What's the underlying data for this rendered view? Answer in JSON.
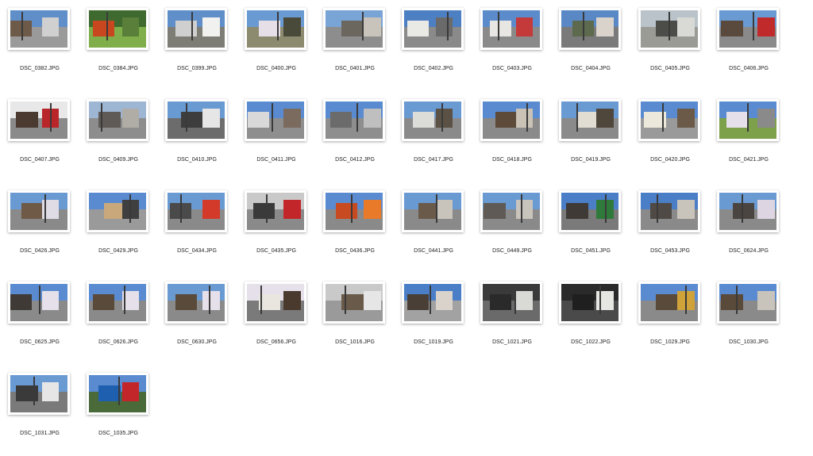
{
  "files": [
    {
      "name": "DSC_0382.JPG",
      "sky": "#5f8ec9",
      "ground": "#9a9a9a",
      "building": "#6e5a48",
      "accent": "#d0d0d0"
    },
    {
      "name": "DSC_0384.JPG",
      "sky": "#3f6a2f",
      "ground": "#7fae4a",
      "building": "#c9471f",
      "accent": "#5a7f3a"
    },
    {
      "name": "DSC_0399.JPG",
      "sky": "#5f8ec9",
      "ground": "#7e7d75",
      "building": "#cfcfcf",
      "accent": "#f1f1ef"
    },
    {
      "name": "DSC_0400.JPG",
      "sky": "#6a9ad2",
      "ground": "#8c8a6f",
      "building": "#e6dfe8",
      "accent": "#4a4a3a"
    },
    {
      "name": "DSC_0401.JPG",
      "sky": "#79a4d6",
      "ground": "#8d8d8d",
      "building": "#6b675f",
      "accent": "#c9c4bb"
    },
    {
      "name": "DSC_0402.JPG",
      "sky": "#4d7fc3",
      "ground": "#8a8a8a",
      "building": "#e9e9e6",
      "accent": "#6a6a6a"
    },
    {
      "name": "DSC_0403.JPG",
      "sky": "#5b8bcb",
      "ground": "#8a8a8a",
      "building": "#e8e6e2",
      "accent": "#c43a3a"
    },
    {
      "name": "DSC_0404.JPG",
      "sky": "#5a88c4",
      "ground": "#7a7a7a",
      "building": "#5d6a4e",
      "accent": "#d9d3cc"
    },
    {
      "name": "DSC_0405.JPG",
      "sky": "#b9c3c9",
      "ground": "#9b9b95",
      "building": "#4c4c48",
      "accent": "#d9d9d5"
    },
    {
      "name": "DSC_0406.JPG",
      "sky": "#6a9ad2",
      "ground": "#8a8a8a",
      "building": "#5a4a3e",
      "accent": "#c02a2a"
    },
    {
      "name": "DSC_0407.JPG",
      "sky": "#e8e8e8",
      "ground": "#8a8a8a",
      "building": "#4a3a30",
      "accent": "#b8262a"
    },
    {
      "name": "DSC_0409.JPG",
      "sky": "#9db6d3",
      "ground": "#8d8d8d",
      "building": "#5f5a55",
      "accent": "#b0aca6"
    },
    {
      "name": "DSC_0410.JPG",
      "sky": "#6a9ad2",
      "ground": "#6c6c6c",
      "building": "#3d3d3d",
      "accent": "#e6e6e6"
    },
    {
      "name": "DSC_0411.JPG",
      "sky": "#5a8bd0",
      "ground": "#8e8e8e",
      "building": "#d9d9d9",
      "accent": "#7b6a5e"
    },
    {
      "name": "DSC_0412.JPG",
      "sky": "#5a8bd0",
      "ground": "#8e8e8e",
      "building": "#6b6b6b",
      "accent": "#bfbfbf"
    },
    {
      "name": "DSC_0417.JPG",
      "sky": "#6a9ad2",
      "ground": "#8a8a8a",
      "building": "#dcdcd8",
      "accent": "#5b5245"
    },
    {
      "name": "DSC_0418.JPG",
      "sky": "#5a8bd0",
      "ground": "#8a8a8a",
      "building": "#5e4a38",
      "accent": "#c9c2b5"
    },
    {
      "name": "DSC_0419.JPG",
      "sky": "#6a9ad2",
      "ground": "#8a8a8a",
      "building": "#e2ddd3",
      "accent": "#4f463c"
    },
    {
      "name": "DSC_0420.JPG",
      "sky": "#5a8bd0",
      "ground": "#9a9a9a",
      "building": "#ede8dc",
      "accent": "#6b5a48"
    },
    {
      "name": "DSC_0421.JPG",
      "sky": "#5a8bd0",
      "ground": "#7da04a",
      "building": "#e6e0ea",
      "accent": "#8a8a8a"
    },
    {
      "name": "DSC_0426.JPG",
      "sky": "#6a9ad2",
      "ground": "#8a8a8a",
      "building": "#6e5a46",
      "accent": "#e0dce6"
    },
    {
      "name": "DSC_0429.JPG",
      "sky": "#5a8bd0",
      "ground": "#9a9a9a",
      "building": "#c9a97c",
      "accent": "#3f3f3f"
    },
    {
      "name": "DSC_0434.JPG",
      "sky": "#6a9ad2",
      "ground": "#8a8a8a",
      "building": "#4a4a4a",
      "accent": "#d33a2a"
    },
    {
      "name": "DSC_0435.JPG",
      "sky": "#c9c9c9",
      "ground": "#8a8a8a",
      "building": "#3a3a3a",
      "accent": "#c2262a"
    },
    {
      "name": "DSC_0436.JPG",
      "sky": "#5a8bd0",
      "ground": "#8a8a8a",
      "building": "#c84a20",
      "accent": "#e87a2a"
    },
    {
      "name": "DSC_0441.JPG",
      "sky": "#6a9ad2",
      "ground": "#8a8a8a",
      "building": "#6a5a4a",
      "accent": "#c9c4bb"
    },
    {
      "name": "DSC_0449.JPG",
      "sky": "#6a9ad2",
      "ground": "#8a8a8a",
      "building": "#5f5a55",
      "accent": "#c9c4bb"
    },
    {
      "name": "DSC_0451.JPG",
      "sky": "#4a7fc8",
      "ground": "#7a7a7a",
      "building": "#3f3a35",
      "accent": "#2f7a3a"
    },
    {
      "name": "DSC_0453.JPG",
      "sky": "#4a7fc8",
      "ground": "#8a8a8a",
      "building": "#4f4a45",
      "accent": "#c9c4bb"
    },
    {
      "name": "DSC_0624.JPG",
      "sky": "#6a9ad2",
      "ground": "#8a8a8a",
      "building": "#4a4540",
      "accent": "#ddd6e2"
    },
    {
      "name": "DSC_0625.JPG",
      "sky": "#5a8bd0",
      "ground": "#8a8a8a",
      "building": "#3f3a35",
      "accent": "#e6e0ea"
    },
    {
      "name": "DSC_0626.JPG",
      "sky": "#5a8bd0",
      "ground": "#8a8a8a",
      "building": "#5a4a3a",
      "accent": "#e6e0ea"
    },
    {
      "name": "DSC_0630.JPG",
      "sky": "#6a9ad2",
      "ground": "#8a8a8a",
      "building": "#5a4a3a",
      "accent": "#e6e0ea"
    },
    {
      "name": "DSC_0656.JPG",
      "sky": "#e6e0ea",
      "ground": "#7a7a7a",
      "building": "#e9e6e0",
      "accent": "#4a3a2e"
    },
    {
      "name": "DSC_1016.JPG",
      "sky": "#c9c9c9",
      "ground": "#9a9a9a",
      "building": "#6a5a4a",
      "accent": "#e6e6e6"
    },
    {
      "name": "DSC_1019.JPG",
      "sky": "#4a7fc8",
      "ground": "#a2a2a2",
      "building": "#4a3f36",
      "accent": "#d9d3cc"
    },
    {
      "name": "DSC_1021.JPG",
      "sky": "#3a3a3a",
      "ground": "#6a6a6a",
      "building": "#2a2a2a",
      "accent": "#d9d9d5"
    },
    {
      "name": "DSC_1022.JPG",
      "sky": "#2a2a2a",
      "ground": "#4a4a4a",
      "building": "#1f1f1f",
      "accent": "#e6e6e2"
    },
    {
      "name": "DSC_1029.JPG",
      "sky": "#5a8bd0",
      "ground": "#8a8a8a",
      "building": "#5a4a3a",
      "accent": "#cfa23a"
    },
    {
      "name": "DSC_1030.JPG",
      "sky": "#5a8bd0",
      "ground": "#8a8a8a",
      "building": "#5a4a3a",
      "accent": "#c9c4bb"
    },
    {
      "name": "DSC_1031.JPG",
      "sky": "#6a9ad2",
      "ground": "#7a7a7a",
      "building": "#3a3a3a",
      "accent": "#e6e6e6"
    },
    {
      "name": "DSC_1035.JPG",
      "sky": "#5a8bd0",
      "ground": "#4a6a3a",
      "building": "#1f5fb0",
      "accent": "#c2262a"
    }
  ]
}
